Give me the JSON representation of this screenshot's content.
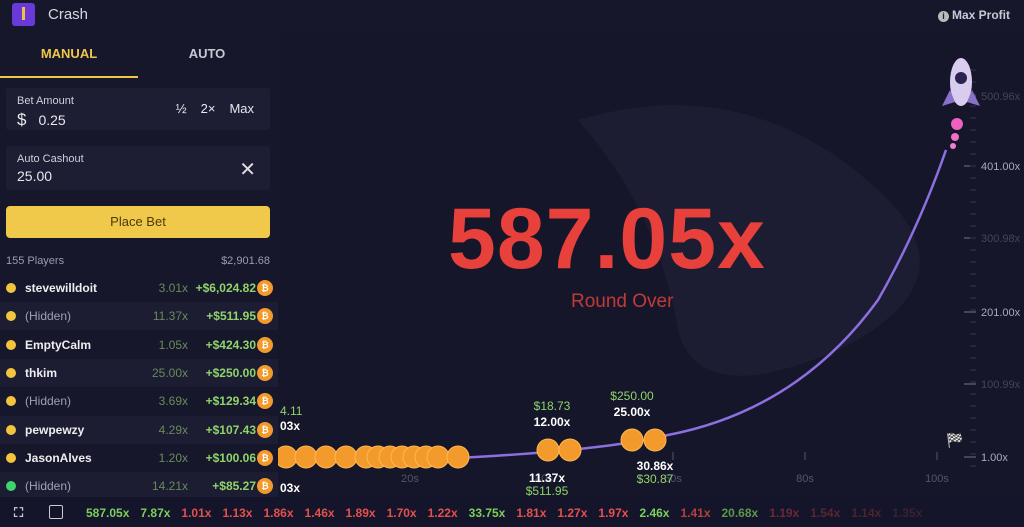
{
  "header": {
    "title": "Crash",
    "logo_icon": "crash-logo",
    "max_profit_label": "Max Profit"
  },
  "tabs": [
    {
      "label": "MANUAL",
      "active": true
    },
    {
      "label": "AUTO",
      "active": false
    }
  ],
  "bet": {
    "label": "Bet Amount",
    "currency": "$",
    "value": "0.25",
    "half": "½",
    "double": "2×",
    "max": "Max"
  },
  "cashout": {
    "label": "Auto Cashout",
    "value": "25.00"
  },
  "place_bet_label": "Place Bet",
  "players": {
    "count_label": "155 Players",
    "total": "$2,901.68",
    "rows": [
      {
        "name": "stevewilldoit",
        "hidden": false,
        "mult": "3.01x",
        "profit": "+$6,024.82",
        "dot": "#f3c43e"
      },
      {
        "name": "(Hidden)",
        "hidden": true,
        "mult": "11.37x",
        "profit": "+$511.95",
        "dot": "#f3c43e"
      },
      {
        "name": "EmptyCalm",
        "hidden": false,
        "mult": "1.05x",
        "profit": "+$424.30",
        "dot": "#f3c43e"
      },
      {
        "name": "thkim",
        "hidden": false,
        "mult": "25.00x",
        "profit": "+$250.00",
        "dot": "#f3c43e"
      },
      {
        "name": "(Hidden)",
        "hidden": true,
        "mult": "3.69x",
        "profit": "+$129.34",
        "dot": "#f3c43e"
      },
      {
        "name": "pewpewzy",
        "hidden": false,
        "mult": "4.29x",
        "profit": "+$107.43",
        "dot": "#f3c43e"
      },
      {
        "name": "JasonAlves",
        "hidden": false,
        "mult": "1.20x",
        "profit": "+$100.06",
        "dot": "#f3c43e"
      },
      {
        "name": "(Hidden)",
        "hidden": true,
        "mult": "14.21x",
        "profit": "+$85.27",
        "dot": "#3fd46a"
      }
    ]
  },
  "game": {
    "multiplier": "587.05x",
    "status": "Round Over",
    "crash_color": "#e8403a",
    "y_axis": [
      "500.96x",
      "401.00x",
      "300.98x",
      "201.00x",
      "100.99x",
      "1.00x"
    ],
    "x_axis": [
      "20s",
      "40s",
      "60s",
      "80s",
      "100s"
    ],
    "cashout_labels": [
      {
        "amount": "4.11",
        "mult": "03x"
      },
      {
        "amount": "$18.73",
        "mult": "12.00x"
      },
      {
        "amount": "$250.00",
        "mult": "25.00x"
      },
      {
        "amount": "$511.95",
        "mult": "11.37x"
      },
      {
        "amount": "$30.87",
        "mult": "30.86x"
      },
      {
        "amount": "",
        "mult": "03x"
      }
    ]
  },
  "history": [
    {
      "v": "587.05x",
      "c": "#7ccf5a"
    },
    {
      "v": "7.87x",
      "c": "#7ccf5a"
    },
    {
      "v": "1.01x",
      "c": "#e4514c"
    },
    {
      "v": "1.13x",
      "c": "#e4514c"
    },
    {
      "v": "1.86x",
      "c": "#e4514c"
    },
    {
      "v": "1.46x",
      "c": "#e4514c"
    },
    {
      "v": "1.89x",
      "c": "#e4514c"
    },
    {
      "v": "1.70x",
      "c": "#e4514c"
    },
    {
      "v": "1.22x",
      "c": "#e4514c"
    },
    {
      "v": "33.75x",
      "c": "#7ccf5a"
    },
    {
      "v": "1.81x",
      "c": "#e4514c"
    },
    {
      "v": "1.27x",
      "c": "#e4514c"
    },
    {
      "v": "1.97x",
      "c": "#e4514c"
    },
    {
      "v": "2.46x",
      "c": "#7ccf5a"
    },
    {
      "v": "1.41x",
      "c": "#b8403c"
    },
    {
      "v": "20.68x",
      "c": "#5a9a48"
    },
    {
      "v": "1.19x",
      "c": "#6a2a34"
    },
    {
      "v": "1.54x",
      "c": "#5a2632"
    },
    {
      "v": "1.14x",
      "c": "#4a2430"
    },
    {
      "v": "1.35x",
      "c": "#3a2230"
    }
  ]
}
